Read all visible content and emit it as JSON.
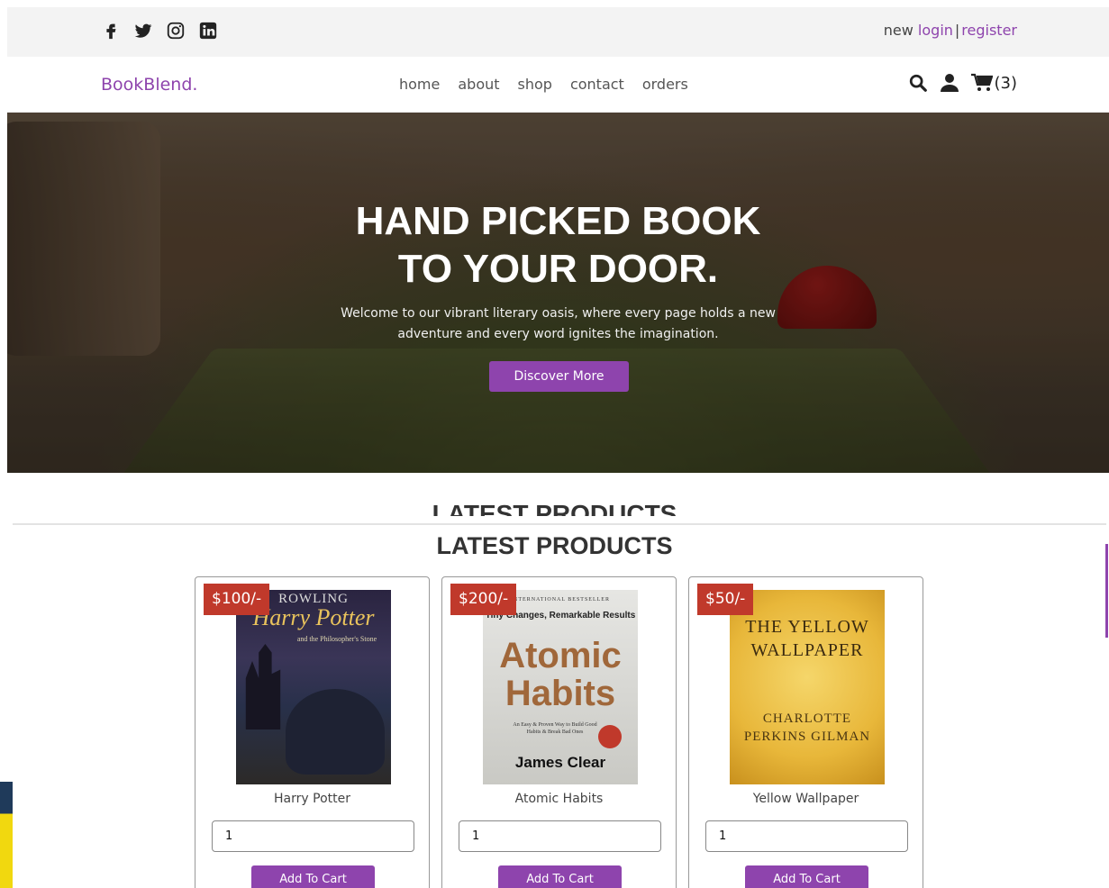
{
  "topbar": {
    "social_icons": [
      "facebook-icon",
      "twitter-icon",
      "instagram-icon",
      "linkedin-icon"
    ],
    "auth_prefix": "new",
    "login_label": "login",
    "separator": "|",
    "register_label": "register"
  },
  "header": {
    "logo": "BookBlend.",
    "nav": [
      "home",
      "about",
      "shop",
      "contact",
      "orders"
    ],
    "cart_count": "(3)"
  },
  "hero": {
    "title_line1": "HAND PICKED BOOK",
    "title_line2": "TO YOUR DOOR.",
    "text": "Welcome to our vibrant literary oasis, where every page holds a new adventure and every word ignites the imagination.",
    "button": "Discover More"
  },
  "sections": {
    "ghost_title": "LATEST PRODUCTS",
    "title": "LATEST PRODUCTS"
  },
  "products": [
    {
      "price": "$100/-",
      "name": "Harry Potter",
      "qty": "1",
      "button": "Add To Cart",
      "cover": {
        "line1": "ROWLING",
        "line2": "Harry Potter",
        "line3": "and the Philosopher's Stone"
      }
    },
    {
      "price": "$200/-",
      "name": "Atomic Habits",
      "qty": "1",
      "button": "Add To Cart",
      "cover": {
        "line1": "INTERNATIONAL BESTSELLER",
        "line2": "Tiny Changes, Remarkable Results",
        "line3": "Atomic Habits",
        "line4": "An Easy & Proven Way to Build Good Habits & Break Bad Ones",
        "author": "James Clear"
      }
    },
    {
      "price": "$50/-",
      "name": "Yellow Wallpaper",
      "qty": "1",
      "button": "Add To Cart",
      "cover": {
        "line1": "THE YELLOW WALLPAPER",
        "line2": "CHARLOTTE PERKINS GILMAN"
      }
    }
  ],
  "colors": {
    "accent": "#8e44ad",
    "price_badge": "#c0392b",
    "topbar_bg": "#f3f3f3"
  }
}
